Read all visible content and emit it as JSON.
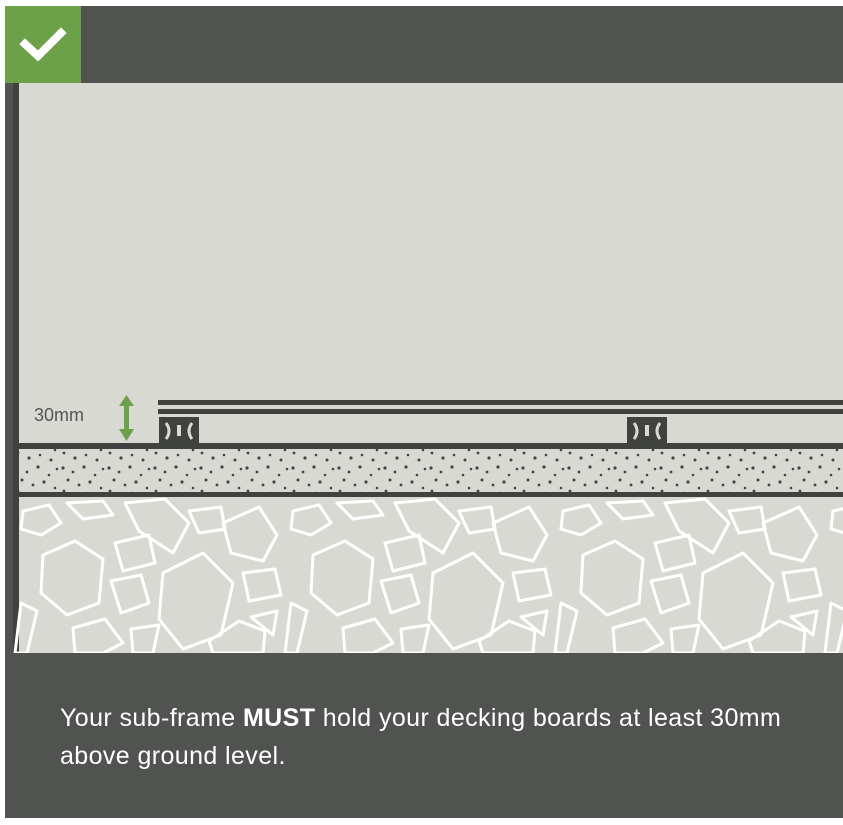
{
  "badge": {
    "icon": "checkmark-icon",
    "color": "#6ca14a"
  },
  "diagram": {
    "height_label": "30mm",
    "arrow_color": "#6ca14a"
  },
  "caption": {
    "part1": "Your sub-frame ",
    "emphasis": "MUST",
    "part2": " hold your decking boards at least 30mm above ground level."
  }
}
